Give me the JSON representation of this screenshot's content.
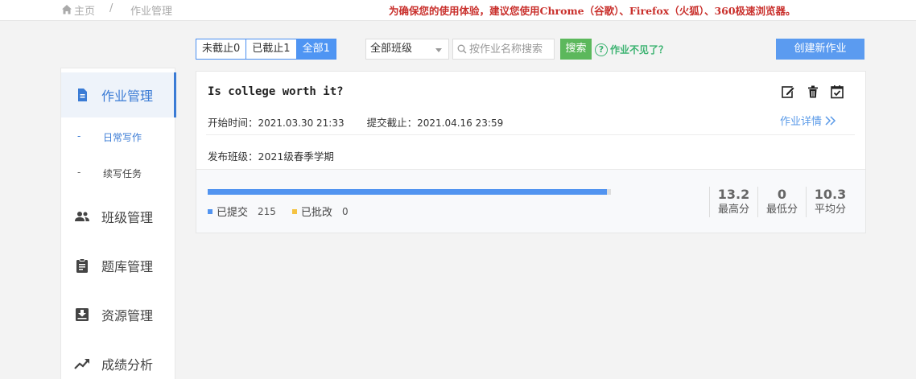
{
  "breadcrumb": {
    "home": "主页",
    "separator": "/",
    "current": "作业管理"
  },
  "notice": "为确保您的使用体验，建议您使用Chrome（谷歌）、Firefox（火狐）、360极速浏览器。",
  "filters": {
    "tabs": [
      {
        "label": "未截止0",
        "active": false
      },
      {
        "label": "已截止1",
        "active": false
      },
      {
        "label": "全部1",
        "active": true
      }
    ],
    "class_select": "全部班级",
    "search_placeholder": "按作业名称搜索",
    "search_button": "搜索",
    "help_text": "作业不见了？",
    "help_icon": "?",
    "create_button": "创建新作业"
  },
  "sidebar": {
    "items": [
      {
        "label": "作业管理",
        "icon": "document-icon",
        "active": true
      },
      {
        "label": "班级管理",
        "icon": "people-icon",
        "active": false
      },
      {
        "label": "题库管理",
        "icon": "clipboard-icon",
        "active": false
      },
      {
        "label": "资源管理",
        "icon": "inbox-icon",
        "active": false
      },
      {
        "label": "成绩分析",
        "icon": "trend-icon",
        "active": false
      }
    ],
    "sub_items": [
      {
        "dash": "-",
        "label": "日常写作",
        "active": true
      },
      {
        "dash": "-",
        "label": "续写任务",
        "active": false
      }
    ]
  },
  "assignment": {
    "title": "Is college worth it?",
    "start_label": "开始时间：",
    "start_value": "2021.03.30 21:33",
    "deadline_label": "提交截止：",
    "deadline_value": "2021.04.16 23:59",
    "detail_link": "作业详情",
    "class_label": "发布班级：",
    "class_value": "2021级春季学期",
    "progress_submitted_fraction": 0.99,
    "submitted_label": "已提交",
    "submitted_count": "215",
    "graded_label": "已批改",
    "graded_count": "0",
    "scores": [
      {
        "value": "13.2",
        "label": "最高分"
      },
      {
        "value": "0",
        "label": "最低分"
      },
      {
        "value": "10.3",
        "label": "平均分"
      }
    ]
  },
  "colors": {
    "accent": "#4f95f3",
    "search": "#5cb85c",
    "warning": "#c9302c",
    "submitted": "#5294f0",
    "graded": "#f5c342"
  }
}
